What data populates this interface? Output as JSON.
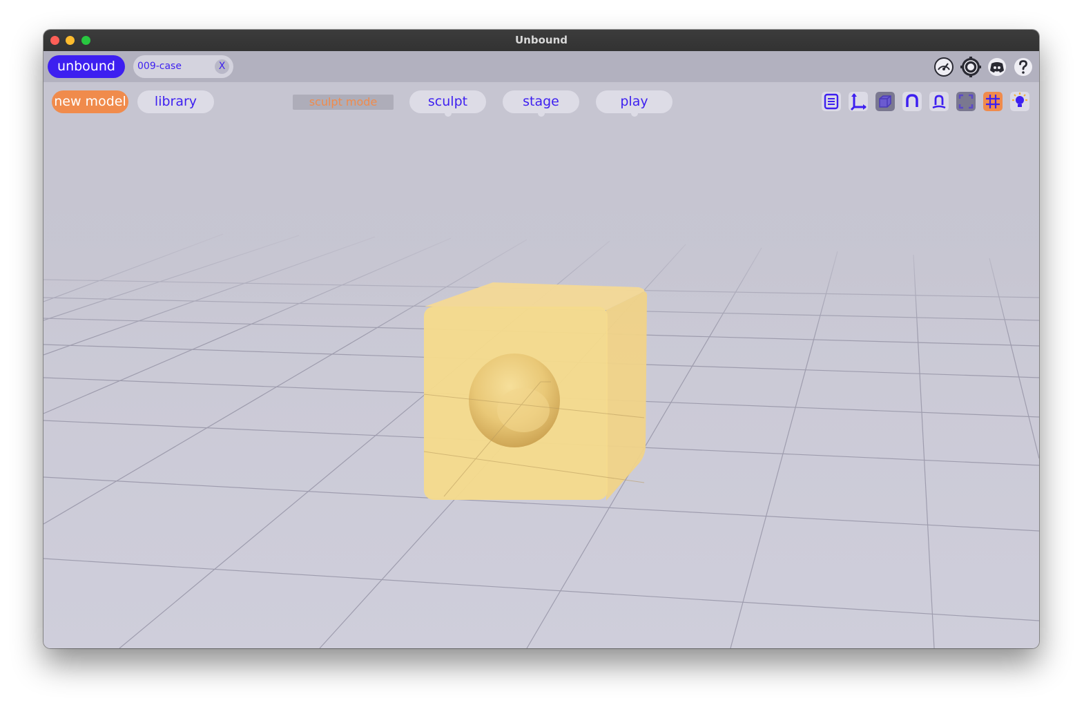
{
  "window": {
    "title": "Unbound"
  },
  "tabbar": {
    "brand": "unbound",
    "file_tab": {
      "name": "009-case",
      "close_label": "X"
    },
    "icons": [
      "speedometer-icon",
      "settings-gear-icon",
      "discord-icon",
      "help-icon"
    ]
  },
  "toolbar": {
    "new_model": "new model",
    "library": "library",
    "mode_label": "sculpt mode",
    "modes": [
      "sculpt",
      "stage",
      "play"
    ],
    "tools": [
      "panel-list-icon",
      "axis-gizmo-icon",
      "cube-toggle-icon",
      "magnet-snap-icon",
      "mirror-icon",
      "frame-fit-icon",
      "grid-icon",
      "light-bulb-icon"
    ]
  },
  "colors": {
    "accent": "#3d1ff0",
    "orange": "#f08b4c",
    "model": "#f5d98c",
    "background": "#c8c7d3"
  }
}
